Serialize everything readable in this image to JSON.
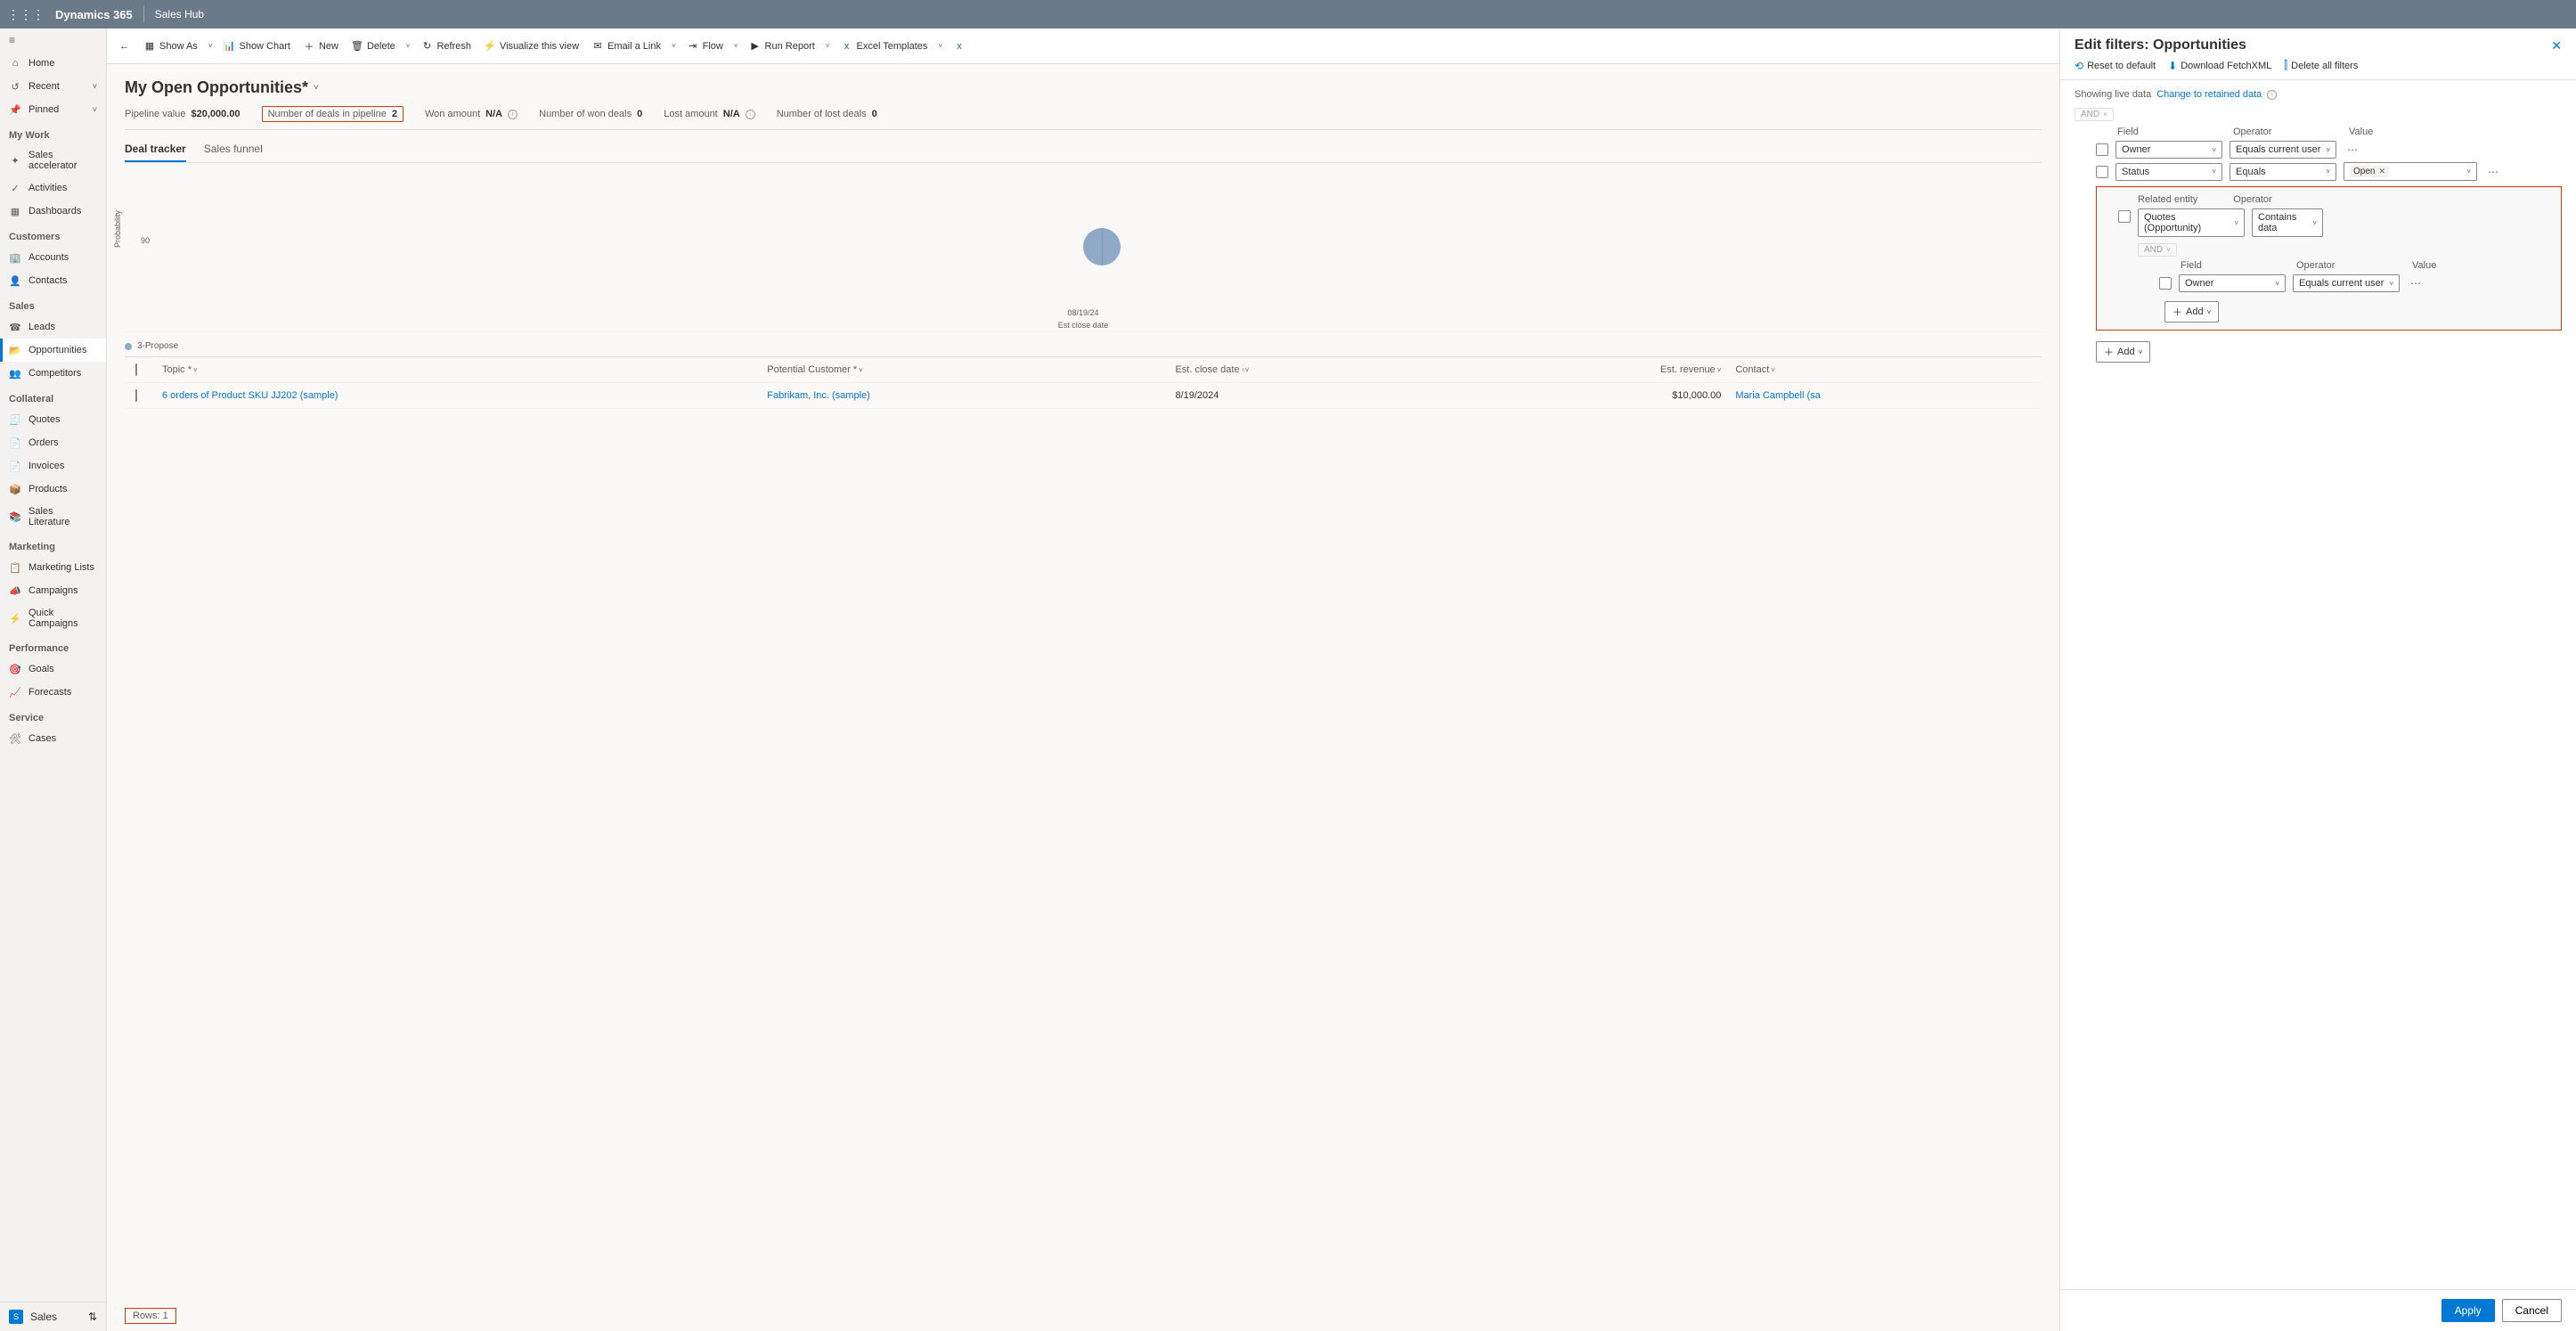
{
  "topbar": {
    "brand": "Dynamics 365",
    "app": "Sales Hub"
  },
  "sidebar": {
    "top": [
      {
        "icon": "⌂",
        "label": "Home"
      },
      {
        "icon": "↺",
        "label": "Recent",
        "chevron": true
      },
      {
        "icon": "📌",
        "label": "Pinned",
        "chevron": true
      }
    ],
    "groups": [
      {
        "header": "My Work",
        "items": [
          {
            "icon": "✦",
            "label": "Sales accelerator"
          },
          {
            "icon": "✓",
            "label": "Activities"
          },
          {
            "icon": "▦",
            "label": "Dashboards"
          }
        ]
      },
      {
        "header": "Customers",
        "items": [
          {
            "icon": "🏢",
            "label": "Accounts"
          },
          {
            "icon": "👤",
            "label": "Contacts"
          }
        ]
      },
      {
        "header": "Sales",
        "items": [
          {
            "icon": "☎",
            "label": "Leads"
          },
          {
            "icon": "📂",
            "label": "Opportunities",
            "active": true
          },
          {
            "icon": "👥",
            "label": "Competitors"
          }
        ]
      },
      {
        "header": "Collateral",
        "items": [
          {
            "icon": "🧾",
            "label": "Quotes"
          },
          {
            "icon": "📄",
            "label": "Orders"
          },
          {
            "icon": "📄",
            "label": "Invoices"
          },
          {
            "icon": "📦",
            "label": "Products"
          },
          {
            "icon": "📚",
            "label": "Sales Literature"
          }
        ]
      },
      {
        "header": "Marketing",
        "items": [
          {
            "icon": "📋",
            "label": "Marketing Lists"
          },
          {
            "icon": "📣",
            "label": "Campaigns"
          },
          {
            "icon": "⚡",
            "label": "Quick Campaigns"
          }
        ]
      },
      {
        "header": "Performance",
        "items": [
          {
            "icon": "🎯",
            "label": "Goals"
          },
          {
            "icon": "📈",
            "label": "Forecasts"
          }
        ]
      },
      {
        "header": "Service",
        "items": [
          {
            "icon": "🛠",
            "label": "Cases"
          }
        ]
      }
    ],
    "area": {
      "badge": "S",
      "label": "Sales"
    }
  },
  "commandbar": {
    "back": "←",
    "items": [
      {
        "icon": "▦",
        "label": "Show As",
        "split": true
      },
      {
        "icon": "📊",
        "label": "Show Chart"
      },
      {
        "icon": "＋",
        "label": "New"
      },
      {
        "icon": "🗑",
        "label": "Delete",
        "split": true
      },
      {
        "icon": "↻",
        "label": "Refresh"
      },
      {
        "icon": "⚡",
        "label": "Visualize this view",
        "iconcolor": "#f2c811"
      },
      {
        "icon": "✉",
        "label": "Email a Link",
        "split": true
      },
      {
        "icon": "⇥",
        "label": "Flow",
        "split": true
      },
      {
        "icon": "▶",
        "label": "Run Report",
        "split": true
      },
      {
        "icon": "x",
        "label": "Excel Templates",
        "split": true,
        "iconcolor": "#107c41"
      },
      {
        "icon": "x",
        "label": "",
        "iconcolor": "#107c41"
      }
    ]
  },
  "view": {
    "title": "My Open Opportunities*",
    "metrics": [
      {
        "label": "Pipeline value",
        "value": "$20,000.00"
      },
      {
        "label": "Number of deals in pipeline",
        "value": "2",
        "boxed": true
      },
      {
        "label": "Won amount",
        "value": "N/A",
        "info": true
      },
      {
        "label": "Number of won deals",
        "value": "0"
      },
      {
        "label": "Lost amount",
        "value": "N/A",
        "info": true
      },
      {
        "label": "Number of lost deals",
        "value": "0"
      }
    ],
    "tabs": [
      {
        "label": "Deal tracker",
        "active": true
      },
      {
        "label": "Sales funnel"
      }
    ],
    "chart": {
      "ylabel": "Probability",
      "ytick": "90",
      "xtick": "08/19/24",
      "xlabel": "Est close date",
      "legend": "3-Propose"
    },
    "columns": [
      {
        "label": "Topic *",
        "sort": "˅"
      },
      {
        "label": "Potential Customer *",
        "sort": "˅"
      },
      {
        "label": "Est. close date",
        "sort": "↑˅"
      },
      {
        "label": "Est. revenue",
        "sort": "˅"
      },
      {
        "label": "Contact",
        "sort": "˅"
      }
    ],
    "rows": [
      {
        "topic": "6 orders of Product SKU JJ202 (sample)",
        "customer": "Fabrikam, Inc. (sample)",
        "date": "8/19/2024",
        "revenue": "$10,000.00",
        "contact": "Maria Campbell (sa"
      }
    ],
    "footer": "Rows: 1"
  },
  "panel": {
    "title": "Edit filters: Opportunities",
    "actions": [
      {
        "icon": "⟲",
        "label": "Reset to default"
      },
      {
        "icon": "⬇",
        "label": "Download FetchXML"
      },
      {
        "icon": "⫿",
        "label": "Delete all filters"
      }
    ],
    "live_text": "Showing live data",
    "link_text": "Change to retained data",
    "root_op": "AND",
    "header": {
      "field": "Field",
      "operator": "Operator",
      "value": "Value"
    },
    "conditions": [
      {
        "field": "Owner",
        "operator": "Equals current user",
        "value": ""
      },
      {
        "field": "Status",
        "operator": "Equals",
        "value_tag": "Open"
      }
    ],
    "related": {
      "label_entity": "Related entity",
      "label_operator": "Operator",
      "entity": "Quotes (Opportunity)",
      "operator": "Contains data",
      "sub_op": "AND",
      "sub_header": {
        "field": "Field",
        "operator": "Operator",
        "value": "Value"
      },
      "sub_conditions": [
        {
          "field": "Owner",
          "operator": "Equals current user"
        }
      ],
      "add": "Add"
    },
    "add": "Add",
    "buttons": {
      "apply": "Apply",
      "cancel": "Cancel"
    }
  }
}
